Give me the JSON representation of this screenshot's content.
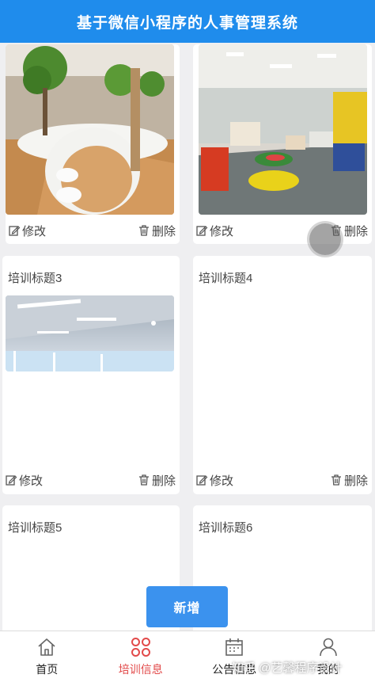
{
  "header": {
    "title": "基于微信小程序的人事管理系统"
  },
  "cards": [
    {
      "title": "",
      "edit_label": "修改",
      "delete_label": "删除"
    },
    {
      "title": "",
      "edit_label": "修改",
      "delete_label": "删除"
    },
    {
      "title": "培训标题3",
      "edit_label": "修改",
      "delete_label": "删除"
    },
    {
      "title": "培训标题4",
      "edit_label": "修改",
      "delete_label": "删除"
    },
    {
      "title": "培训标题5"
    },
    {
      "title": "培训标题6"
    }
  ],
  "add_button": {
    "label": "新增"
  },
  "tabbar": {
    "items": [
      {
        "label": "首页",
        "icon": "home-icon"
      },
      {
        "label": "培训信息",
        "icon": "clover-icon",
        "active": true
      },
      {
        "label": "公告信息",
        "icon": "calendar-icon"
      },
      {
        "label": "我的",
        "icon": "user-icon"
      }
    ]
  },
  "watermark": "知乎 @艺馨程序设计",
  "colors": {
    "header": "#1f8cec",
    "active_tab": "#e24a4a",
    "add_button": "#3b92ee"
  }
}
